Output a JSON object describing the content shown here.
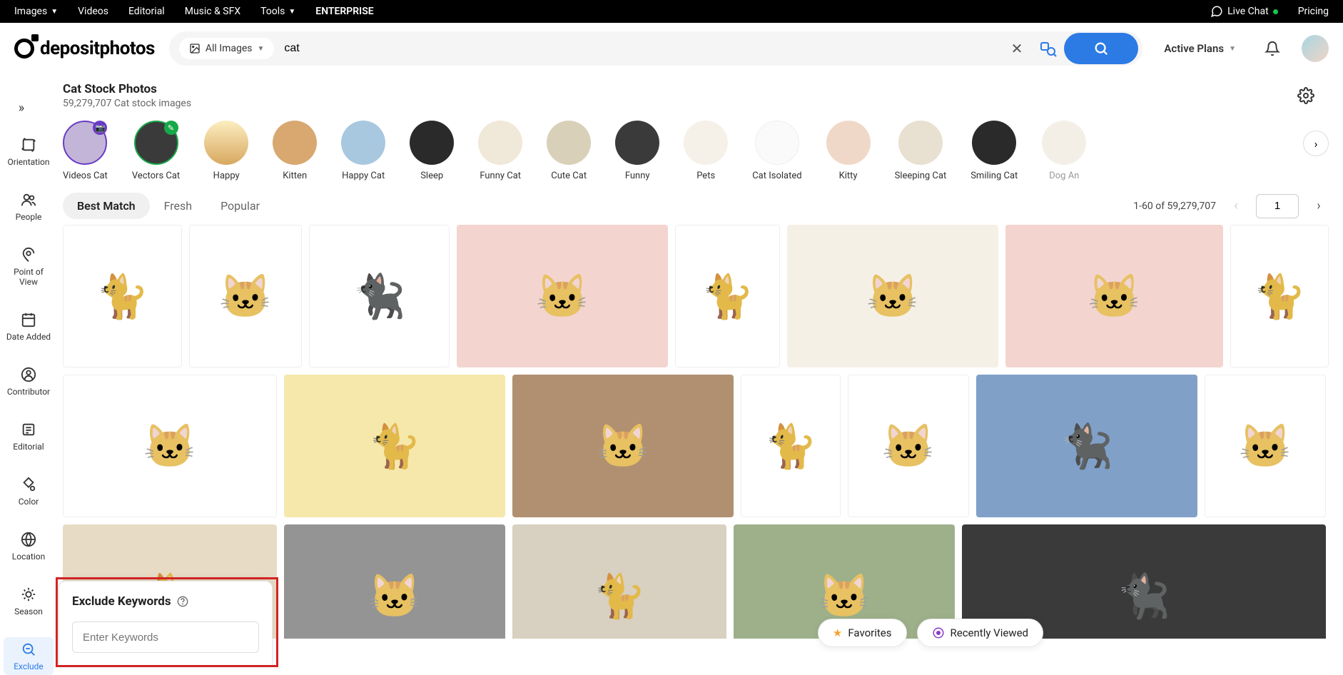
{
  "top_nav": {
    "items": [
      "Images",
      "Videos",
      "Editorial",
      "Music & SFX",
      "Tools",
      "ENTERPRISE"
    ],
    "live_chat": "Live Chat",
    "pricing": "Pricing"
  },
  "logo_text": "depositphotos",
  "search": {
    "category": "All Images",
    "query": "cat",
    "active_plans": "Active Plans"
  },
  "page": {
    "title": "Cat Stock Photos",
    "subtitle": "59,279,707 Cat stock images"
  },
  "categories": [
    {
      "label": "Videos Cat",
      "ring": "purple",
      "badge": "purple"
    },
    {
      "label": "Vectors Cat",
      "ring": "green",
      "badge": "green"
    },
    {
      "label": "Happy"
    },
    {
      "label": "Kitten"
    },
    {
      "label": "Happy Cat"
    },
    {
      "label": "Sleep"
    },
    {
      "label": "Funny Cat"
    },
    {
      "label": "Cute Cat"
    },
    {
      "label": "Funny"
    },
    {
      "label": "Pets"
    },
    {
      "label": "Cat Isolated"
    },
    {
      "label": "Kitty"
    },
    {
      "label": "Sleeping Cat"
    },
    {
      "label": "Smiling Cat"
    },
    {
      "label": "Dog An"
    }
  ],
  "sidebar": [
    {
      "label": "Orientation",
      "icon": "orientation"
    },
    {
      "label": "People",
      "icon": "people"
    },
    {
      "label": "Point of View",
      "icon": "pov"
    },
    {
      "label": "Date Added",
      "icon": "date"
    },
    {
      "label": "Contributor",
      "icon": "contributor"
    },
    {
      "label": "Editorial",
      "icon": "editorial"
    },
    {
      "label": "Color",
      "icon": "color"
    },
    {
      "label": "Location",
      "icon": "location"
    },
    {
      "label": "Season",
      "icon": "season"
    },
    {
      "label": "Exclude",
      "icon": "exclude",
      "active": true
    }
  ],
  "tabs": [
    "Best Match",
    "Fresh",
    "Popular"
  ],
  "active_tab": "Best Match",
  "pager": {
    "range": "1-60 of 59,279,707",
    "page": "1"
  },
  "exclude": {
    "title": "Exclude Keywords",
    "placeholder": "Enter Keywords"
  },
  "bottom": {
    "favorites": "Favorites",
    "recent": "Recently Viewed"
  }
}
